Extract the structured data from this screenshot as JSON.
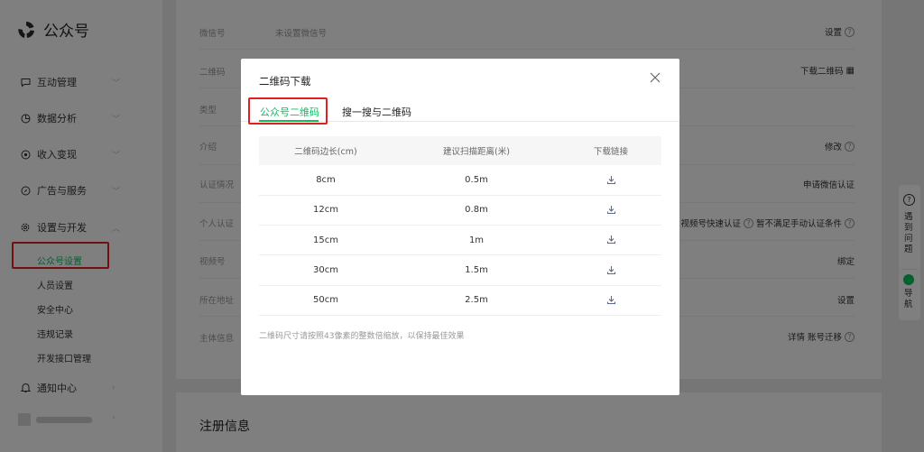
{
  "brand": {
    "name": "公众号"
  },
  "sidebar": {
    "items": [
      {
        "label": "互动管理",
        "icon": "chat-bubble-icon"
      },
      {
        "label": "数据分析",
        "icon": "pie-chart-icon"
      },
      {
        "label": "收入变现",
        "icon": "coin-icon"
      },
      {
        "label": "广告与服务",
        "icon": "compass-icon"
      },
      {
        "label": "设置与开发",
        "icon": "gear-icon"
      }
    ],
    "sub_items": [
      {
        "label": "公众号设置",
        "active": true
      },
      {
        "label": "人员设置"
      },
      {
        "label": "安全中心"
      },
      {
        "label": "违规记录"
      },
      {
        "label": "开发接口管理"
      }
    ],
    "notice": {
      "label": "通知中心",
      "icon": "bell-icon"
    }
  },
  "main": {
    "rows": [
      {
        "label": "微信号",
        "value": "未设置微信号",
        "action": "设置",
        "help": true
      },
      {
        "label": "二维码",
        "value": "",
        "action": "下载二维码"
      },
      {
        "label": "类型",
        "value": "",
        "action": ""
      },
      {
        "label": "介绍",
        "value": "",
        "action": "修改",
        "help": true
      },
      {
        "label": "认证情况",
        "value": "",
        "action": "申请微信认证"
      },
      {
        "label": "个人认证",
        "value": "",
        "action": "视频号快速认证",
        "action2": "暂不满足手动认证条件"
      },
      {
        "label": "视频号",
        "value": "",
        "action": "绑定"
      },
      {
        "label": "所在地址",
        "value": "",
        "action": "设置"
      },
      {
        "label": "主体信息",
        "value": "",
        "action": "详情 账号迁移",
        "help": true
      }
    ],
    "register_title": "注册信息"
  },
  "modal": {
    "title": "二维码下载",
    "tabs": [
      "公众号二维码",
      "搜一搜与二维码"
    ],
    "table": {
      "headers": [
        "二维码边长(cm)",
        "建议扫描距离(米)",
        "下载链接"
      ],
      "rows": [
        [
          "8cm",
          "0.5m"
        ],
        [
          "12cm",
          "0.8m"
        ],
        [
          "15cm",
          "1m"
        ],
        [
          "30cm",
          "1.5m"
        ],
        [
          "50cm",
          "2.5m"
        ]
      ]
    },
    "tip": "二维码尺寸请按照43像素的整数倍缩放，以保持最佳效果"
  },
  "float_helper": {
    "ask": "遇到问题",
    "guide": "导航"
  },
  "colors": {
    "accent": "#07c160",
    "highlight": "#e02020"
  }
}
